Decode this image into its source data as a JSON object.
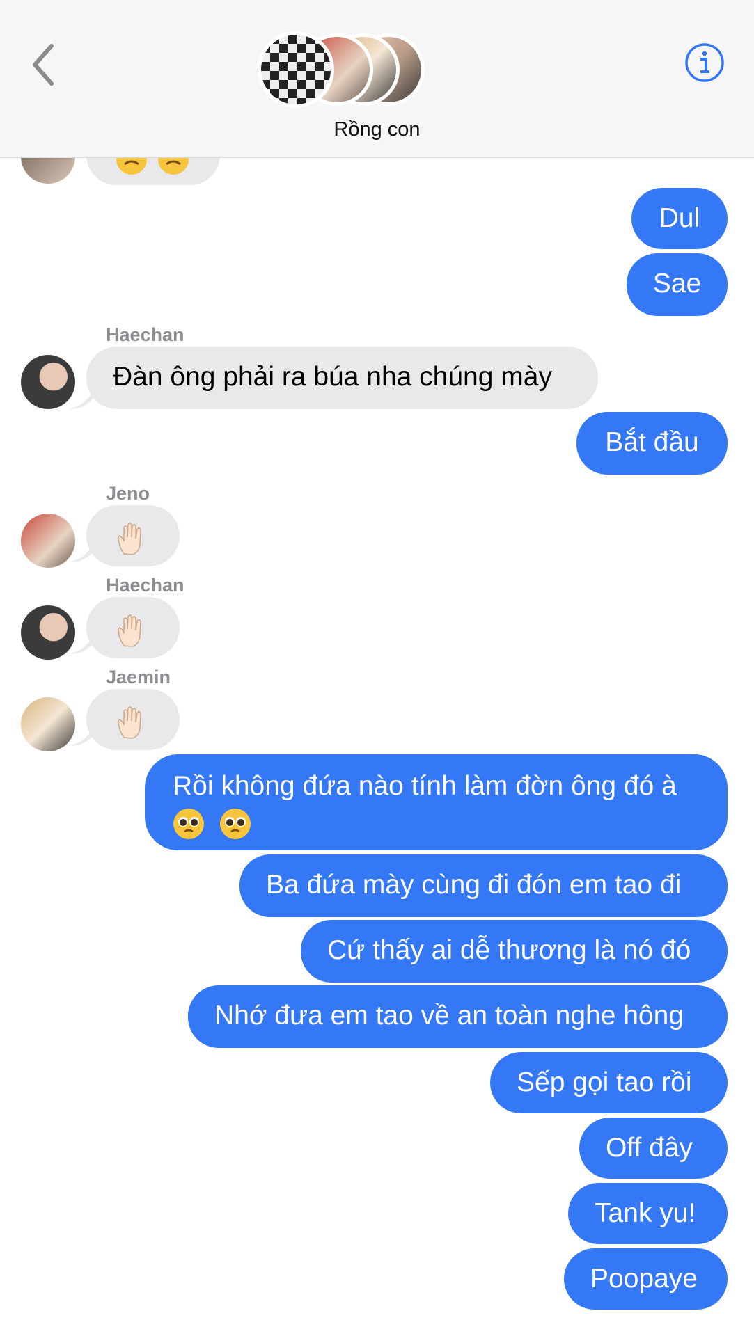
{
  "header": {
    "group_name": "Rồng con",
    "back_icon": "chevron-left-icon",
    "info_icon": "info-icon",
    "accent": "#3478f6"
  },
  "messages": {
    "out_dul": "Dul",
    "out_sae": "Sae",
    "in_haechan_name": "Haechan",
    "in_haechan_text": "Đàn ông phải ra búa nha chúng mày",
    "out_batdau": "Bắt đầu",
    "in_jeno_name": "Jeno",
    "in_jeno_emoji": "raised-hand-icon",
    "in_haechan2_name": "Haechan",
    "in_haechan2_emoji": "raised-hand-icon",
    "in_jaemin_name": "Jaemin",
    "in_jaemin_emoji": "raised-hand-icon",
    "out_roi_line1": "Rồi không đứa nào tính làm đờn ông đó à",
    "out_roi_emoji": "pleading-face-icon",
    "out_ba": "Ba đứa mày cùng đi đón em tao đi",
    "out_cu": "Cứ thấy ai dễ thương là nó đó",
    "out_nho": "Nhớ đưa em tao về an toàn nghe hông",
    "out_sep": "Sếp gọi tao rồi",
    "out_off": "Off đây",
    "out_tank": "Tank yu!",
    "out_poo": "Poopaye"
  },
  "colors": {
    "outgoing_bubble": "#3478f6",
    "incoming_bubble": "#e9e9eb",
    "sender_name": "#8e8e93",
    "header_bg": "#f6f6f6"
  }
}
